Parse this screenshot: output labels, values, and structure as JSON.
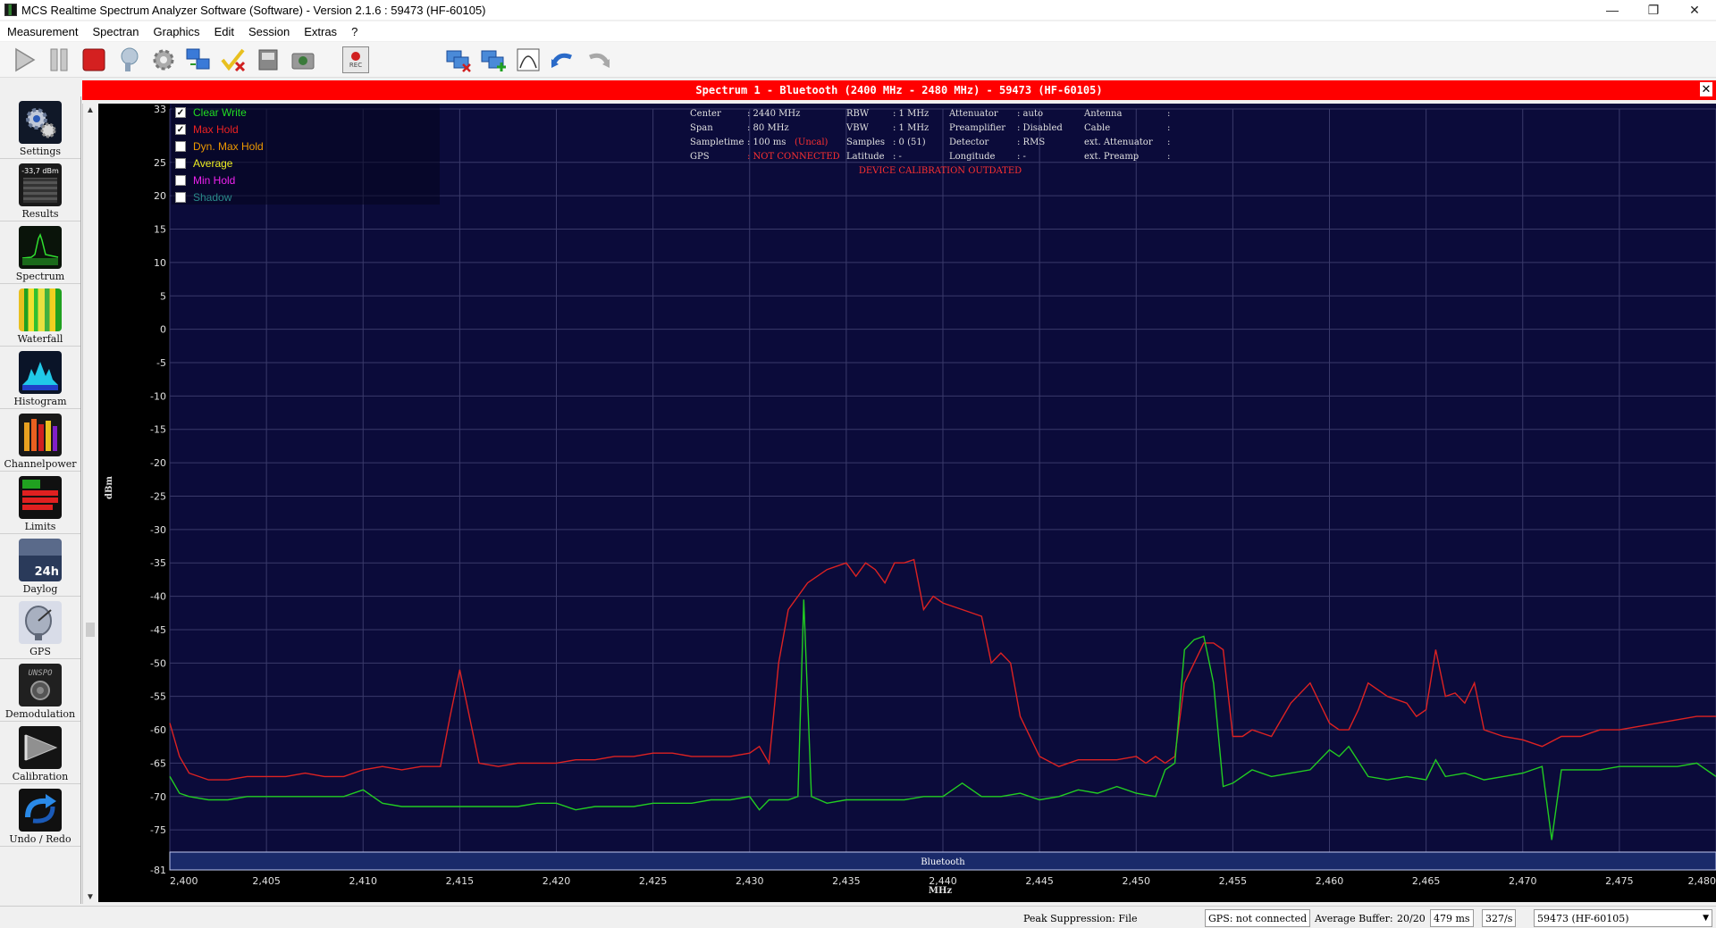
{
  "window": {
    "title": "MCS Realtime Spectrum Analyzer Software (Software) - Version 2.1.6 : 59473 (HF-60105)"
  },
  "menu": [
    "Measurement",
    "Spectran",
    "Graphics",
    "Edit",
    "Session",
    "Extras",
    "?"
  ],
  "toolbar": {
    "buttons": [
      "play-icon",
      "pause-icon",
      "stop-icon",
      "probe-icon",
      "gear-gray-icon",
      "network-monitor-icon",
      "check-cross-icon",
      "device-icon",
      "camera-icon",
      "record-icon",
      "marker-remove-icon",
      "marker-add-icon",
      "bell-shape-icon",
      "undo-arrow-icon",
      "redo-arrow-icon"
    ],
    "record_label": "REC"
  },
  "sidebar": {
    "items": [
      {
        "label": "Settings",
        "icon": "settings-gears-icon"
      },
      {
        "label": "Results",
        "icon": "results-display-icon",
        "icon_text": "-33,7 dBm"
      },
      {
        "label": "Spectrum",
        "icon": "spectrum-icon"
      },
      {
        "label": "Waterfall",
        "icon": "waterfall-icon"
      },
      {
        "label": "Histogram",
        "icon": "histogram-icon"
      },
      {
        "label": "Channelpower",
        "icon": "channelpower-icon"
      },
      {
        "label": "Limits",
        "icon": "limits-icon"
      },
      {
        "label": "Daylog",
        "icon": "daylog-icon",
        "icon_text": "24h"
      },
      {
        "label": "GPS",
        "icon": "gps-dish-icon"
      },
      {
        "label": "Demodulation",
        "icon": "demodulation-radio-icon",
        "icon_text": "UNSPO"
      },
      {
        "label": "Calibration",
        "icon": "calibration-icon"
      },
      {
        "label": "Undo / Redo",
        "icon": "undo-redo-icon"
      }
    ]
  },
  "spectrum": {
    "header": "Spectrum 1 - Bluetooth (2400 MHz - 2480 MHz) - 59473 (HF-60105)",
    "traces": [
      {
        "label": "Clear Write",
        "checked": true,
        "color": "#22dd22"
      },
      {
        "label": "Max Hold",
        "checked": true,
        "color": "#ee2222"
      },
      {
        "label": "Dyn. Max Hold",
        "checked": false,
        "color": "#ee9900"
      },
      {
        "label": "Average",
        "checked": false,
        "color": "#eeee22"
      },
      {
        "label": "Min Hold",
        "checked": false,
        "color": "#ee22ee"
      },
      {
        "label": "Shadow",
        "checked": false,
        "color": "#2a8a8a"
      }
    ],
    "info": {
      "col1": [
        [
          "Center",
          ": 2440 MHz"
        ],
        [
          "Span",
          ": 80 MHz"
        ],
        [
          "Sampletime",
          ": 100 ms"
        ],
        [
          "GPS",
          ": NOT CONNECTED"
        ]
      ],
      "uncal": "(Uncal)",
      "col2": [
        [
          "RBW",
          ": 1 MHz"
        ],
        [
          "VBW",
          ": 1 MHz"
        ],
        [
          "Samples",
          ": 0 (51)"
        ],
        [
          "Latitude",
          ": -"
        ]
      ],
      "col3": [
        [
          "Attenuator",
          ": auto"
        ],
        [
          "Preamplifier",
          ": Disabled"
        ],
        [
          "Detector",
          ": RMS"
        ],
        [
          "Longitude",
          ": -"
        ]
      ],
      "col4": [
        [
          "Antenna",
          ":"
        ],
        [
          "Cable",
          ":"
        ],
        [
          "ext. Attenuator",
          ":"
        ],
        [
          "ext. Preamp",
          ":"
        ]
      ],
      "warning": "DEVICE CALIBRATION OUTDATED"
    },
    "band_label": "Bluetooth",
    "ylabel": "dBm",
    "xlabel": "MHz"
  },
  "chart_data": {
    "type": "line",
    "title": "Spectrum 1 - Bluetooth (2400 MHz - 2480 MHz) - 59473 (HF-60105)",
    "xlabel": "MHz",
    "ylabel": "dBm",
    "xlim": [
      2400,
      2480
    ],
    "ylim": [
      -81,
      33
    ],
    "y_ticks": [
      33,
      25,
      20,
      15,
      10,
      5,
      0,
      -5,
      -10,
      -15,
      -20,
      -25,
      -30,
      -35,
      -40,
      -45,
      -50,
      -55,
      -60,
      -65,
      -70,
      -75,
      -81
    ],
    "x_ticks": [
      "2,400",
      "2,405",
      "2,410",
      "2,415",
      "2,420",
      "2,425",
      "2,430",
      "2,435",
      "2,440",
      "2,445",
      "2,450",
      "2,455",
      "2,460",
      "2,465",
      "2,470",
      "2,475",
      "2,480"
    ],
    "x_tick_values": [
      2400,
      2405,
      2410,
      2415,
      2420,
      2425,
      2430,
      2435,
      2440,
      2445,
      2450,
      2455,
      2460,
      2465,
      2470,
      2475,
      2480
    ],
    "grid": true,
    "series": [
      {
        "name": "Max Hold",
        "color": "#dd2222",
        "x": [
          2400,
          2400.5,
          2401,
          2402,
          2403,
          2404,
          2405,
          2406,
          2407,
          2408,
          2409,
          2410,
          2411,
          2412,
          2413,
          2414,
          2414.5,
          2415,
          2415.5,
          2416,
          2417,
          2418,
          2419,
          2420,
          2421,
          2422,
          2423,
          2424,
          2425,
          2426,
          2427,
          2428,
          2429,
          2430,
          2430.5,
          2431,
          2431.5,
          2432,
          2432.5,
          2433,
          2434,
          2435,
          2435.5,
          2436,
          2436.5,
          2437,
          2437.5,
          2438,
          2438.5,
          2439,
          2439.5,
          2440,
          2441,
          2442,
          2442.5,
          2443,
          2443.5,
          2444,
          2445,
          2446,
          2447,
          2448,
          2449,
          2450,
          2450.5,
          2451,
          2451.5,
          2452,
          2452.5,
          2453,
          2453.5,
          2454,
          2454.5,
          2455,
          2455.5,
          2456,
          2457,
          2458,
          2459,
          2459.5,
          2460,
          2460.5,
          2461,
          2461.5,
          2462,
          2463,
          2464,
          2464.5,
          2465,
          2465.5,
          2466,
          2466.5,
          2467,
          2467.5,
          2468,
          2469,
          2470,
          2471,
          2472,
          2473,
          2474,
          2475,
          2476,
          2477,
          2478,
          2479,
          2480
        ],
        "y": [
          -59,
          -64,
          -66.5,
          -67.5,
          -67.5,
          -67,
          -67,
          -67,
          -66.5,
          -67,
          -67,
          -66,
          -65.5,
          -66,
          -65.5,
          -65.5,
          -58,
          -51,
          -58,
          -65,
          -65.5,
          -65,
          -65,
          -65,
          -64.5,
          -64.5,
          -64,
          -64,
          -63.5,
          -63.5,
          -64,
          -64,
          -64,
          -63.5,
          -62.5,
          -65,
          -50,
          -42,
          -40,
          -38,
          -36,
          -35,
          -37,
          -35,
          -36,
          -38,
          -35,
          -35,
          -34.5,
          -42,
          -40,
          -41,
          -42,
          -43,
          -50,
          -48.5,
          -50,
          -58,
          -64,
          -65.5,
          -64.5,
          -64.5,
          -64.5,
          -64,
          -65,
          -64,
          -65,
          -64,
          -53,
          -50,
          -47,
          -47,
          -48,
          -61,
          -61,
          -60,
          -61,
          -56,
          -53,
          -56,
          -59,
          -60,
          -60,
          -57,
          -53,
          -55,
          -56,
          -58,
          -57,
          -48,
          -55,
          -54.5,
          -56,
          -53,
          -60,
          -61,
          -61.5,
          -62.5,
          -61,
          -61,
          -60,
          -60,
          -59.5,
          -59,
          -58.5,
          -58,
          -58
        ]
      },
      {
        "name": "Clear Write",
        "color": "#22cc22",
        "x": [
          2400,
          2400.5,
          2401,
          2402,
          2403,
          2404,
          2405,
          2406,
          2407,
          2408,
          2409,
          2410,
          2411,
          2412,
          2413,
          2414,
          2415,
          2416,
          2417,
          2418,
          2419,
          2420,
          2421,
          2422,
          2423,
          2424,
          2425,
          2426,
          2427,
          2428,
          2429,
          2430,
          2430.5,
          2431,
          2432,
          2432.5,
          2432.8,
          2433.2,
          2433.6,
          2434,
          2435,
          2436,
          2437,
          2438,
          2439,
          2440,
          2441,
          2442,
          2443,
          2444,
          2445,
          2446,
          2447,
          2448,
          2449,
          2450,
          2451,
          2451.5,
          2452,
          2452.5,
          2453,
          2453.5,
          2454,
          2454.5,
          2455,
          2456,
          2457,
          2458,
          2459,
          2460,
          2460.5,
          2461,
          2462,
          2463,
          2464,
          2465,
          2465.5,
          2466,
          2467,
          2468,
          2469,
          2470,
          2470.5,
          2471,
          2471.5,
          2472,
          2472.5,
          2473,
          2474,
          2475,
          2476,
          2477,
          2478,
          2479,
          2480
        ],
        "y": [
          -67,
          -69.5,
          -70,
          -70.5,
          -70.5,
          -70,
          -70,
          -70,
          -70,
          -70,
          -70,
          -69,
          -71,
          -71.5,
          -71.5,
          -71.5,
          -71.5,
          -71.5,
          -71.5,
          -71.5,
          -71,
          -71,
          -72,
          -71.5,
          -71.5,
          -71.5,
          -71,
          -71,
          -71,
          -70.5,
          -70.5,
          -70,
          -72,
          -70.5,
          -70.5,
          -70,
          -40.5,
          -70,
          -70.5,
          -71,
          -70.5,
          -70.5,
          -70.5,
          -70.5,
          -70,
          -70,
          -68,
          -70,
          -70,
          -69.5,
          -70.5,
          -70,
          -69,
          -69.5,
          -68.5,
          -69.5,
          -70,
          -66,
          -65,
          -48,
          -46.5,
          -46,
          -53,
          -68.5,
          -68,
          -66,
          -67,
          -66.5,
          -66,
          -63,
          -64,
          -62.5,
          -67,
          -67.5,
          -67,
          -67.5,
          -64.5,
          -67,
          -66.5,
          -67.5,
          -67,
          -66.5,
          -66,
          -65.5,
          -76.5,
          -66,
          -66,
          -66,
          -66,
          -65.5,
          -65.5,
          -65.5,
          -65.5,
          -65,
          -67
        ]
      }
    ]
  },
  "status": {
    "peak": "Peak Suppression: File",
    "gps": "GPS: not connected",
    "avg_label": "Average Buffer:",
    "avg_value": "20/20",
    "ms": "479 ms",
    "rate": "327/s",
    "device": "59473 (HF-60105)"
  }
}
